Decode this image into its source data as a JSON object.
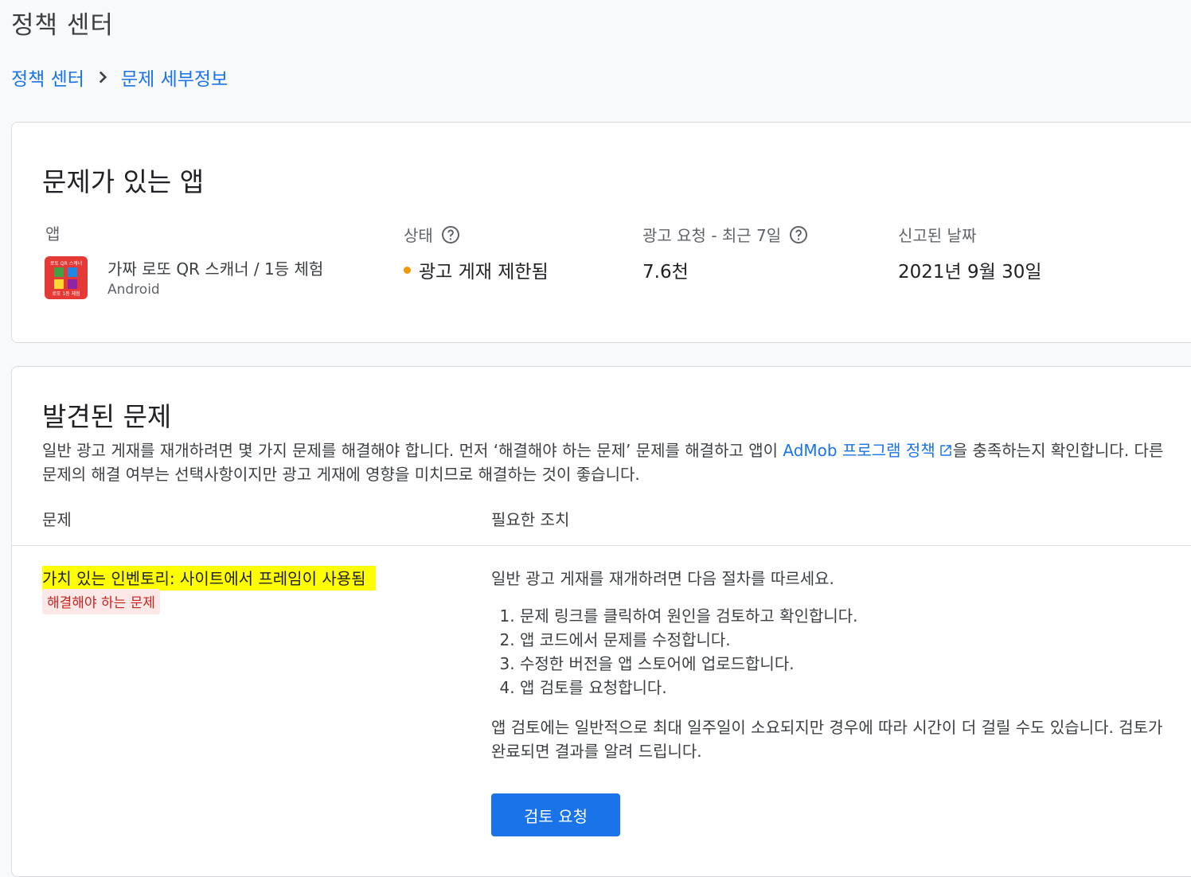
{
  "page": {
    "title": "정책 센터"
  },
  "breadcrumb": {
    "root": "정책 센터",
    "current": "문제 세부정보"
  },
  "app_card": {
    "title": "문제가 있는 앱",
    "headers": {
      "app": "앱",
      "status": "상태",
      "ad_requests": "광고 요청 - 최근 7일",
      "reported": "신고된 날짜"
    },
    "app": {
      "name": "가짜 로또 QR 스캐너 / 1등 체험",
      "platform": "Android",
      "icon_top_text": "로또 QR 스캐너",
      "icon_bottom_text": "로또 1등 체험"
    },
    "status": {
      "label": "광고 게재 제한됨",
      "color": "#f29900"
    },
    "ad_requests": "7.6천",
    "reported_date": "2021년 9월 30일"
  },
  "issues_card": {
    "title": "발견된 문제",
    "desc_before": "일반 광고 게재를 재개하려면 몇 가지 문제를 해결해야 합니다. 먼저 ‘해결해야 하는 문제’ 문제를 해결하고 앱이 ",
    "desc_link": "AdMob 프로그램 정책",
    "desc_after": "을 충족하는지 확인합니다. 다른 문제의 해결 여부는 선택사항이지만 광고 게재에 영향을 미치므로 해결하는 것이 좋습니다.",
    "col_issue": "문제",
    "col_action": "필요한 조치",
    "issue": {
      "name": "가치 있는 인벤토리: 사이트에서 프레임이 사용됨",
      "badge": "해결해야 하는 문제"
    },
    "action": {
      "intro": "일반 광고 게재를 재개하려면 다음 절차를 따르세요.",
      "steps": [
        "문제 링크를 클릭하여 원인을 검토하고 확인합니다.",
        "앱 코드에서 문제를 수정합니다.",
        "수정한 버전을 앱 스토어에 업로드합니다.",
        "앱 검토를 요청합니다."
      ],
      "note": "앱 검토에는 일반적으로 최대 일주일이 소요되지만 경우에 따라 시간이 더 걸릴 수도 있습니다. 검토가 완료되면 결과를 알려 드립니다.",
      "button": "검토 요청"
    }
  },
  "colors": {
    "link": "#1a73e8",
    "button": "#1a73e8",
    "highlight": "#ffff00",
    "badge_bg": "#fce8e6",
    "badge_text": "#c5221f"
  }
}
